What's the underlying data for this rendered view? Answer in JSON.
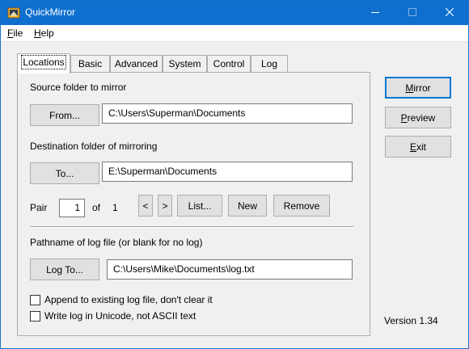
{
  "window": {
    "title": "QuickMirror",
    "colors": {
      "titlebar": "#0e6fcf",
      "focus": "#0078d7",
      "face": "#f0f0f0"
    },
    "controls": {
      "minimize_icon": "minimize-icon",
      "maximize_icon": "maximize-icon",
      "close_icon": "close-icon"
    }
  },
  "menu": {
    "file": {
      "hotkey": "F",
      "rest": "ile"
    },
    "help": {
      "hotkey": "H",
      "rest": "elp"
    }
  },
  "tabs": [
    {
      "label": "Locations",
      "active": true
    },
    {
      "label": "Basic"
    },
    {
      "label": "Advanced"
    },
    {
      "label": "System"
    },
    {
      "label": "Control"
    },
    {
      "label": "Log"
    }
  ],
  "locations": {
    "source_label": "Source folder to mirror",
    "from_button": "From...",
    "source_path": "C:\\Users\\Superman\\Documents",
    "destination_label": "Destination folder of mirroring",
    "to_button": "To...",
    "destination_path": "E:\\Superman\\Documents",
    "pair_label": "Pair",
    "pair_value": "1",
    "of_label": "of",
    "pair_total": "1",
    "prev_button": "<",
    "next_button": ">",
    "list_button": "List...",
    "new_button": "New",
    "remove_button": "Remove",
    "log_label": "Pathname of log file (or blank for no log)",
    "log_to_button": "Log To...",
    "log_path": "C:\\Users\\Mike\\Documents\\log.txt",
    "append_label": "Append to existing log file, don't clear it",
    "append_checked": false,
    "unicode_label": "Write log in Unicode, not ASCII text",
    "unicode_checked": false
  },
  "actions": {
    "mirror": {
      "hotkey": "M",
      "rest": "irror"
    },
    "preview": {
      "hotkey": "P",
      "rest": "review"
    },
    "exit": {
      "hotkey": "E",
      "rest": "xit"
    }
  },
  "version": "Version 1.34"
}
